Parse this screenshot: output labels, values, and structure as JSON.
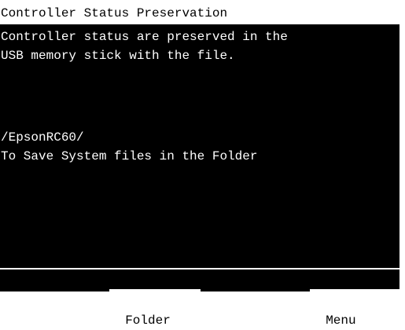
{
  "screen": {
    "title": "Controller Status Preservation",
    "description_lines": [
      "Controller status are preserved in the",
      "USB memory stick with the file."
    ],
    "folder_path": "/EpsonRC60/",
    "instruction": "To Save System files in the Folder"
  },
  "soft_keys": {
    "folder_label": "Folder",
    "menu_label": "Menu"
  },
  "colors": {
    "background": "#000000",
    "foreground": "#ffffff",
    "title_background": "#ffffff",
    "title_text": "#000000"
  }
}
